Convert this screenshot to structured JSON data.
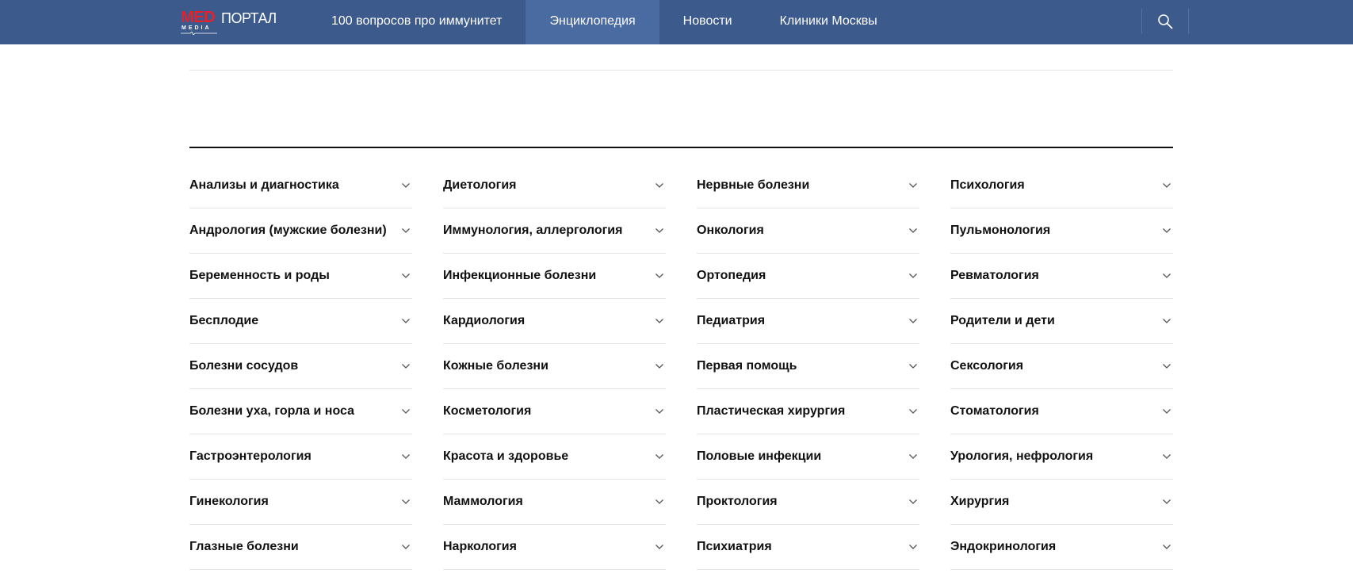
{
  "header": {
    "logo": {
      "med": "MED",
      "portal": "ПОРТАЛ",
      "media": "MEDIA"
    },
    "nav": [
      {
        "label": "100 вопросов про иммунитет",
        "active": false
      },
      {
        "label": "Энциклопедия",
        "active": true
      },
      {
        "label": "Новости",
        "active": false
      },
      {
        "label": "Клиники Москвы",
        "active": false
      }
    ],
    "search_icon": "search-icon"
  },
  "colors": {
    "header_bg": "#3d5a8c",
    "nav_active_bg": "#4a6aa2",
    "logo_red": "#e8202a"
  },
  "categories": {
    "columns": [
      [
        "Анализы и диагностика",
        "Андрология (мужские болезни)",
        "Беременность и роды",
        "Бесплодие",
        "Болезни сосудов",
        "Болезни уха, горла и носа",
        "Гастроэнтерология",
        "Гинекология",
        "Глазные болезни"
      ],
      [
        "Диетология",
        "Иммунология, аллергология",
        "Инфекционные болезни",
        "Кардиология",
        "Кожные болезни",
        "Косметология",
        "Красота и здоровье",
        "Маммология",
        "Наркология"
      ],
      [
        "Нервные болезни",
        "Онкология",
        "Ортопедия",
        "Педиатрия",
        "Первая помощь",
        "Пластическая хирургия",
        "Половые инфекции",
        "Проктология",
        "Психиатрия"
      ],
      [
        "Психология",
        "Пульмонология",
        "Ревматология",
        "Родители и дети",
        "Сексология",
        "Стоматология",
        "Урология, нефрология",
        "Хирургия",
        "Эндокринология"
      ]
    ],
    "expand_icon": "chevron-down-icon"
  }
}
